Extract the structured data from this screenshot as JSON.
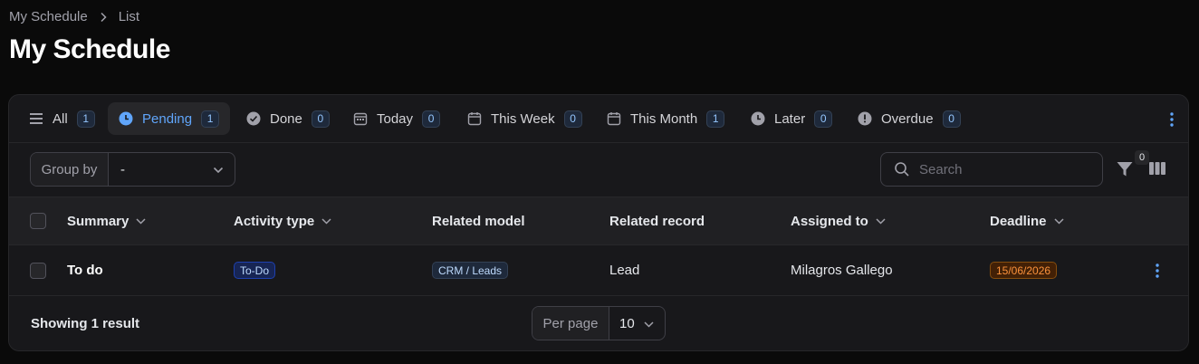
{
  "breadcrumb": {
    "items": [
      "My Schedule",
      "List"
    ]
  },
  "page_title": "My Schedule",
  "tabs": [
    {
      "label": "All",
      "count": "1",
      "icon": "list-icon"
    },
    {
      "label": "Pending",
      "count": "1",
      "icon": "clock-icon",
      "active": true
    },
    {
      "label": "Done",
      "count": "0",
      "icon": "check-circle-icon"
    },
    {
      "label": "Today",
      "count": "0",
      "icon": "calendar-today-icon"
    },
    {
      "label": "This Week",
      "count": "0",
      "icon": "calendar-icon"
    },
    {
      "label": "This Month",
      "count": "1",
      "icon": "calendar-icon"
    },
    {
      "label": "Later",
      "count": "0",
      "icon": "clock-icon"
    },
    {
      "label": "Overdue",
      "count": "0",
      "icon": "alert-circle-icon"
    }
  ],
  "toolbar": {
    "group_by_label": "Group by",
    "group_by_value": "-",
    "search_placeholder": "Search",
    "filter_count": "0"
  },
  "table": {
    "columns": [
      "Summary",
      "Activity type",
      "Related model",
      "Related record",
      "Assigned to",
      "Deadline"
    ],
    "rows": [
      {
        "summary": "To do",
        "activity_type": "To-Do",
        "related_model": "CRM / Leads",
        "related_record": "Lead",
        "assigned_to": "Milagros Gallego",
        "deadline": "15/06/2026"
      }
    ]
  },
  "footer": {
    "showing": "Showing 1 result",
    "per_page_label": "Per page",
    "per_page_value": "10"
  },
  "colors": {
    "background": "#0a0a0a",
    "panel": "#18181b",
    "accent": "#60a5fa",
    "deadline": "#fb923c"
  }
}
